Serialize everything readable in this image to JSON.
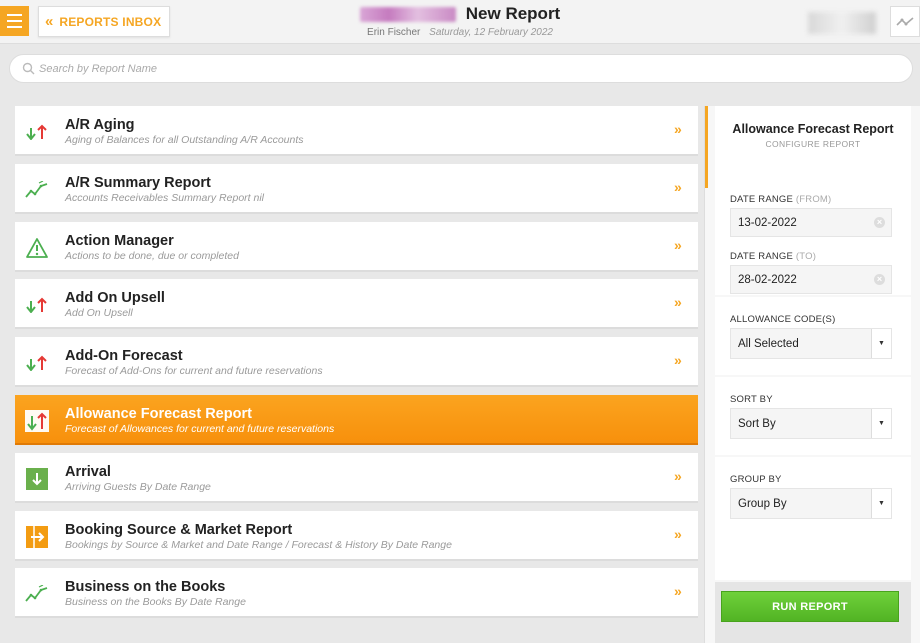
{
  "header": {
    "inbox_label": "REPORTS INBOX",
    "title": "New Report",
    "user": "Erin Fischer",
    "date": "Saturday, 12 February 2022"
  },
  "search": {
    "placeholder": "Search by Report Name"
  },
  "reports": [
    {
      "title": "A/R Aging",
      "desc": "Aging of Balances for all Outstanding A/R Accounts",
      "icon": "up-down-arrows-icon"
    },
    {
      "title": "A/R Summary Report",
      "desc": "Accounts Receivables Summary Report nil",
      "icon": "trend-line-icon"
    },
    {
      "title": "Action Manager",
      "desc": "Actions to be done, due or completed",
      "icon": "warning-icon"
    },
    {
      "title": "Add On Upsell",
      "desc": "Add On Upsell",
      "icon": "up-down-arrows-icon"
    },
    {
      "title": "Add-On Forecast",
      "desc": "Forecast of Add-Ons for current and future reservations",
      "icon": "up-down-arrows-icon"
    },
    {
      "title": "Allowance Forecast Report",
      "desc": "Forecast of Allowances for current and future reservations",
      "icon": "up-down-arrows-icon"
    },
    {
      "title": "Arrival",
      "desc": "Arriving Guests By Date Range",
      "icon": "arrival-icon"
    },
    {
      "title": "Booking Source & Market Report",
      "desc": "Bookings by Source & Market and Date Range / Forecast & History By Date Range",
      "icon": "booking-source-icon"
    },
    {
      "title": "Business on the Books",
      "desc": "Business on the Books By Date Range",
      "icon": "trend-line-icon"
    }
  ],
  "panel": {
    "title": "Allowance Forecast Report",
    "subtitle": "CONFIGURE REPORT",
    "date_from_label": "DATE RANGE",
    "date_from_hint": "(FROM)",
    "date_from_value": "13-02-2022",
    "date_to_label": "DATE RANGE",
    "date_to_hint": "(TO)",
    "date_to_value": "28-02-2022",
    "allowance_label": "ALLOWANCE CODE(S)",
    "allowance_value": "All Selected",
    "sort_label": "SORT BY",
    "sort_value": "Sort By",
    "group_label": "GROUP BY",
    "group_value": "Group By",
    "run_label": "RUN REPORT"
  },
  "colors": {
    "accent": "#f5a623",
    "active_row": "#f7900c",
    "run_green": "#5cc22e"
  }
}
